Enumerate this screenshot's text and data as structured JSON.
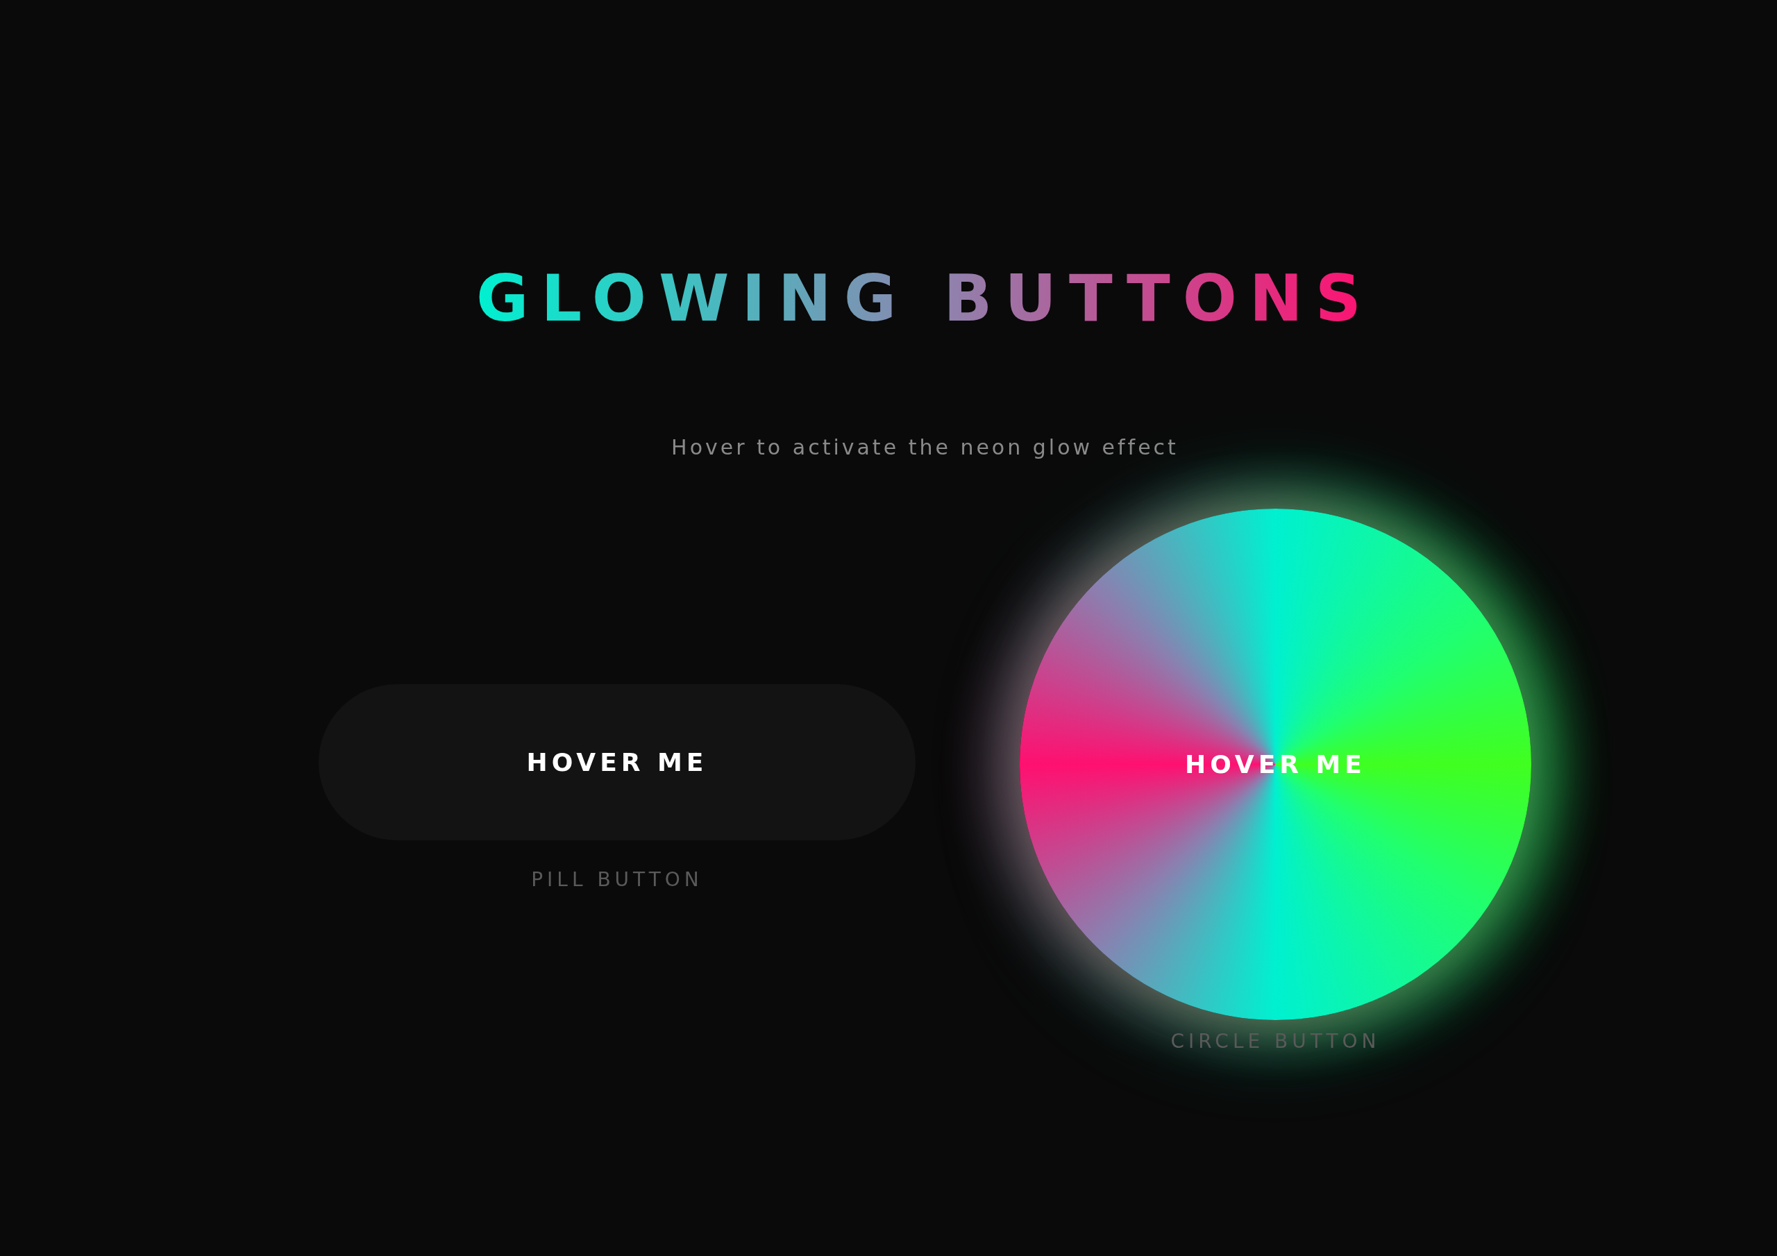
{
  "title": "GLOWING BUTTONS",
  "subtitle": "Hover to activate the neon glow effect",
  "buttons": [
    {
      "kind": "pill",
      "label": "HOVER ME",
      "caption": "PILL BUTTON",
      "glowing": false
    },
    {
      "kind": "circle",
      "label": "HOVER ME",
      "caption": "CIRCLE BUTTON",
      "glowing": true
    }
  ]
}
